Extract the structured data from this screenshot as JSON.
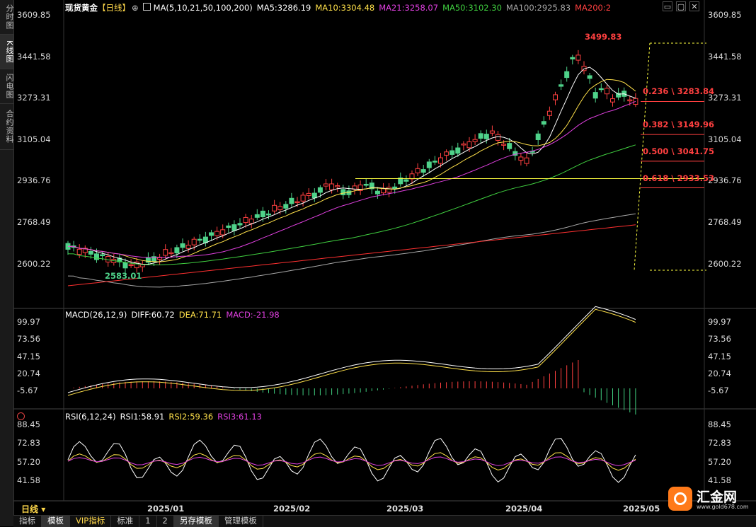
{
  "sidebar": {
    "tabs": [
      "分时图",
      "K线图",
      "闪电图",
      "合约资料"
    ],
    "active_index": 1
  },
  "main": {
    "title": "现货黄金",
    "period_tag": "【日线】",
    "ma_legend": [
      {
        "text": "MA(5,10,21,50,100,200)",
        "color": "#ffffff"
      },
      {
        "text": "MA5:3286.19",
        "color": "#ffffff"
      },
      {
        "text": "MA10:3304.48",
        "color": "#ffe14a"
      },
      {
        "text": "MA21:3258.07",
        "color": "#e040e0"
      },
      {
        "text": "MA50:3102.30",
        "color": "#40d040"
      },
      {
        "text": "MA100:2925.83",
        "color": "#a8a8a8"
      },
      {
        "text": "MA200:2",
        "color": "#ff4040"
      }
    ],
    "y_ticks": [
      "3609.85",
      "3441.58",
      "3273.31",
      "3105.04",
      "2936.76",
      "2768.49",
      "2600.22"
    ],
    "peak_label": "3499.83",
    "low_label": "2583.01",
    "fib_labels": [
      "0.236 \\ 3283.84",
      "0.382 \\ 3149.96",
      "0.500 \\ 3041.75",
      "0.618 \\ 2933.53"
    ]
  },
  "macd": {
    "legend": [
      {
        "text": "MACD(26,12,9)",
        "color": "#ffffff"
      },
      {
        "text": "DIFF:60.72",
        "color": "#ffffff"
      },
      {
        "text": "DEA:71.71",
        "color": "#ffe14a"
      },
      {
        "text": "MACD:-21.98",
        "color": "#e040e0"
      }
    ],
    "y_ticks": [
      "99.97",
      "73.56",
      "47.15",
      "20.74",
      "-5.67"
    ]
  },
  "rsi": {
    "legend": [
      {
        "text": "RSI(6,12,24)",
        "color": "#ffffff"
      },
      {
        "text": "RSI1:58.91",
        "color": "#ffffff"
      },
      {
        "text": "RSI2:59.36",
        "color": "#ffe14a"
      },
      {
        "text": "RSI3:61.13",
        "color": "#e040e0"
      }
    ],
    "y_ticks": [
      "88.45",
      "72.83",
      "57.20",
      "41.58"
    ]
  },
  "x_axis": {
    "labels": [
      "2025/01",
      "2025/02",
      "2025/03",
      "2025/04",
      "2025/05"
    ]
  },
  "period_button": "日线",
  "bottom_bar": [
    "指标",
    "模板",
    "VIP指标",
    "标准",
    "1",
    "2",
    "另存模板",
    "管理模板"
  ],
  "bottom_active": [
    1,
    6
  ],
  "logo": {
    "name": "汇金网",
    "url": "www.gold678.com"
  },
  "window_controls": [
    "minimize-icon",
    "restore-icon",
    "close-icon"
  ]
}
